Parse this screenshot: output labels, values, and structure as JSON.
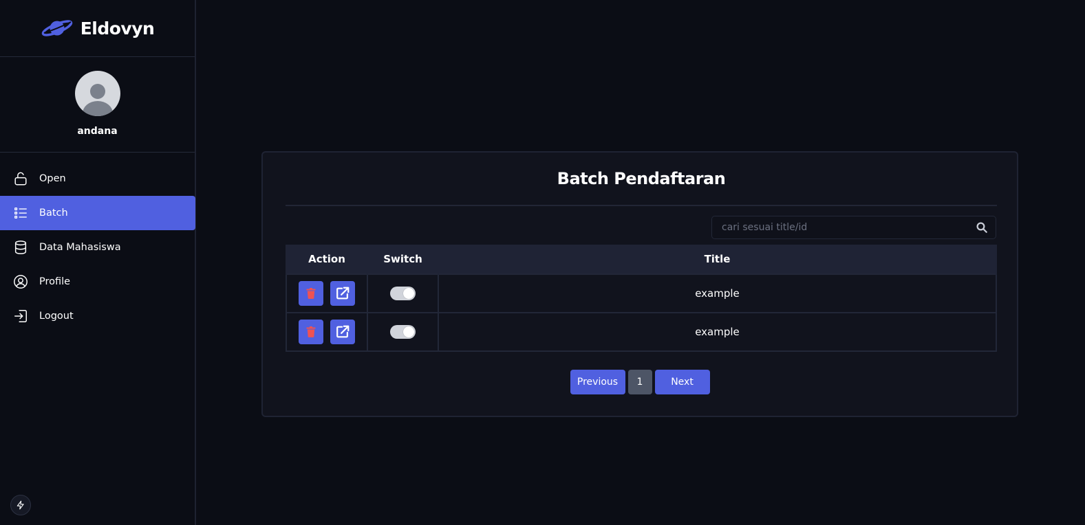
{
  "brand": {
    "name": "Eldovyn"
  },
  "user": {
    "name": "andana"
  },
  "sidebar": {
    "items": [
      {
        "label": "Open",
        "icon": "unlock-icon",
        "active": false
      },
      {
        "label": "Batch",
        "icon": "list-icon",
        "active": true
      },
      {
        "label": "Data Mahasiswa",
        "icon": "database-icon",
        "active": false
      },
      {
        "label": "Profile",
        "icon": "user-circle-icon",
        "active": false
      },
      {
        "label": "Logout",
        "icon": "logout-icon",
        "active": false
      }
    ]
  },
  "main": {
    "title": "Batch Pendaftaran",
    "search": {
      "placeholder": "cari sesuai title/id",
      "value": ""
    },
    "table": {
      "headers": {
        "action": "Action",
        "switch": "Switch",
        "title": "Title"
      },
      "rows": [
        {
          "title": "example",
          "switch_on": true
        },
        {
          "title": "example",
          "switch_on": true
        }
      ]
    },
    "pagination": {
      "previous": "Previous",
      "page": "1",
      "next": "Next"
    }
  },
  "colors": {
    "accent": "#5060e0",
    "background": "#0b0d15",
    "card": "#11131d",
    "delete_icon": "#f05252"
  }
}
